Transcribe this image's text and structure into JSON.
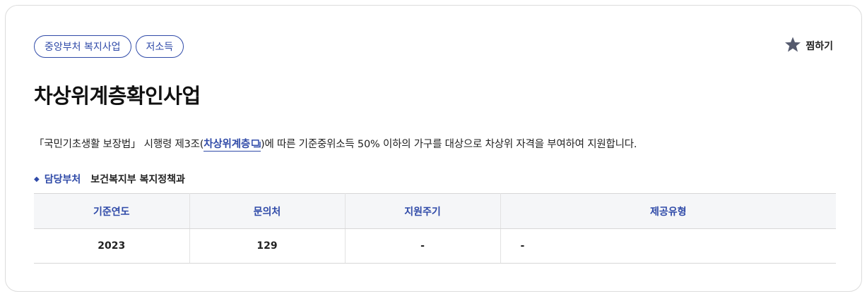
{
  "tags": [
    "중앙부처 복지사업",
    "저소득"
  ],
  "favorite": {
    "label": "찜하기",
    "icon": "star-icon"
  },
  "title": "차상위계층확인사업",
  "description": {
    "before": "「국민기초생활 보장법」 시행령 제3조(",
    "term": "차상위계층",
    "term_icon": "popup-window-icon",
    "after": ")에 따른 기준중위소득 50% 이하의 가구를 대상으로 차상위 자격을 부여하여 지원합니다."
  },
  "department": {
    "label": "담당부처",
    "value": "보건복지부 복지정책과"
  },
  "table": {
    "headers": [
      "기준연도",
      "문의처",
      "지원주기",
      "제공유형"
    ],
    "rows": [
      [
        "2023",
        "129",
        "-",
        "-"
      ]
    ]
  },
  "colors": {
    "accent": "#2f4aa8",
    "header_bg": "#f5f6f8",
    "star": "#555a6e"
  }
}
